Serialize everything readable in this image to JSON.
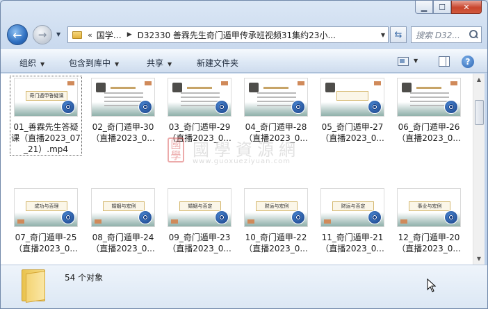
{
  "nav": {
    "address": {
      "overflow": "«",
      "crumb1": "国学…",
      "crumb2": "D32330 善霖先生奇门遁甲传承班视频31集约23小..."
    },
    "search_placeholder": "搜索 D32..."
  },
  "toolbar": {
    "organize": "组织",
    "include_library": "包含到库中",
    "share": "共享",
    "new_folder": "新建文件夹"
  },
  "files": [
    {
      "name": "01_善霖先生答疑课（直播2023_07_21）.mp4",
      "thumb": "title"
    },
    {
      "name": "02_奇门遁甲-30（直播2023_0...",
      "thumb": "doc"
    },
    {
      "name": "03_奇门遁甲-29（直播2023_0...",
      "thumb": "doc"
    },
    {
      "name": "04_奇门遁甲-28（直播2023_0...",
      "thumb": "doc"
    },
    {
      "name": "05_奇门遁甲-27（直播2023_0...",
      "thumb": "scroll"
    },
    {
      "name": "06_奇门遁甲-26（直播2023_0...",
      "thumb": "doc"
    },
    {
      "name": "07_奇门遁甲-25（直播2023_0...",
      "thumb": "card",
      "card": "成功与否理"
    },
    {
      "name": "08_奇门遁甲-24（直播2023_0...",
      "thumb": "card",
      "card": "婚姻与宏例"
    },
    {
      "name": "09_奇门遁甲-23（直播2023_0...",
      "thumb": "card",
      "card": "婚姻与否定"
    },
    {
      "name": "10_奇门遁甲-22（直播2023_0...",
      "thumb": "card",
      "card": "财运与宏例"
    },
    {
      "name": "11_奇门遁甲-21（直播2023_0...",
      "thumb": "card",
      "card": "财运与否定"
    },
    {
      "name": "12_奇门遁甲-20（直播2023_0...",
      "thumb": "card",
      "card": "事业与宏例"
    }
  ],
  "first_thumb_title": "奇门遁甲答疑课",
  "watermark": {
    "seal": "國學",
    "text": "國學資源網",
    "url": "www.guoxueziyuan.com"
  },
  "status": {
    "count": "54 个对象"
  }
}
